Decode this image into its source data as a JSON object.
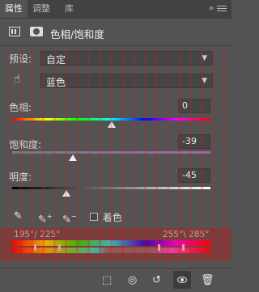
{
  "tabs": [
    {
      "label": "属性",
      "active": true
    },
    {
      "label": "调整",
      "active": false
    },
    {
      "label": "库",
      "active": false
    }
  ],
  "window": {
    "collapse_glyph": "»",
    "close_glyph": "×"
  },
  "header": {
    "title": "色相/饱和度",
    "icons": [
      "adjustment-layer-icon",
      "mask-icon"
    ]
  },
  "preset": {
    "label": "预设:",
    "value": "自定"
  },
  "channel": {
    "value": "蓝色",
    "icon": "hand-target-icon"
  },
  "hue": {
    "label": "色相:",
    "value": "0",
    "position": 0.5
  },
  "saturation": {
    "label": "饱和度:",
    "value": "-39",
    "position": 0.305
  },
  "lightness": {
    "label": "明度:",
    "value": "-45",
    "position": 0.275
  },
  "colorize": {
    "label": "着色",
    "checked": false
  },
  "eyedroppers": [
    "eyedropper-icon",
    "eyedropper-add-icon",
    "eyedropper-subtract-icon"
  ],
  "range": {
    "left": "195°/ 225°",
    "right": "255°\\ 285°"
  },
  "bottom_bar": [
    "clip-to-layer-icon",
    "view-previous-icon",
    "reset-icon",
    "visibility-icon",
    "trash-icon"
  ],
  "colors": {
    "panel_bg": "#535353",
    "tab_bar_bg": "#424242",
    "input_bg": "#454545"
  }
}
